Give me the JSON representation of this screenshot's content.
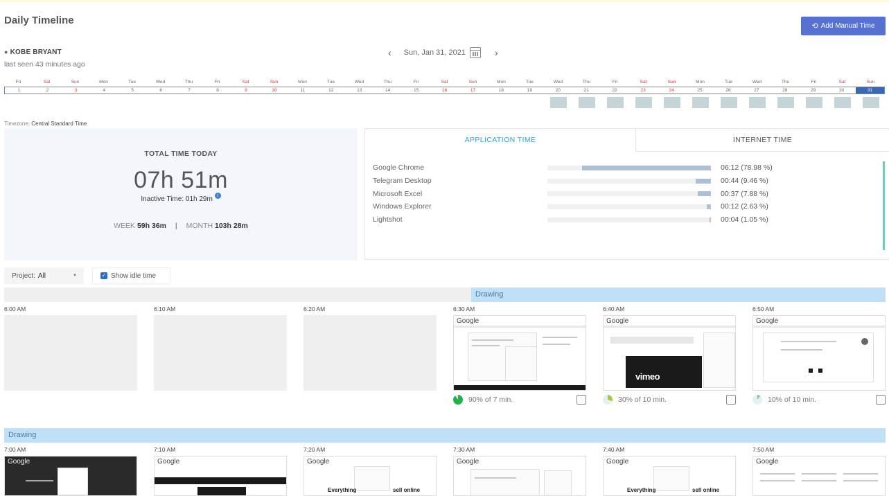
{
  "header": {
    "title": "Daily Timeline",
    "add_manual_time": "Add Manual Time",
    "add_icon": "clock-plus-icon"
  },
  "user": {
    "name": "KOBE BRYANT",
    "last_seen": "last seen 43 minutes ago"
  },
  "date_nav": {
    "date": "Sun, Jan 31, 2021"
  },
  "day_strip": {
    "days": [
      "Fri",
      "Sat",
      "Sun",
      "Mon",
      "Tue",
      "Wed",
      "Thu",
      "Fri",
      "Sat",
      "Sun",
      "Mon",
      "Tue",
      "Wed",
      "Thu",
      "Fri",
      "Sat",
      "Sun",
      "Mon",
      "Tue",
      "Wed",
      "Thu",
      "Fri",
      "Sat",
      "Sun",
      "Mon",
      "Tue",
      "Wed",
      "Thu",
      "Fri",
      "Sat",
      "Sun"
    ],
    "numbers": [
      "1",
      "2",
      "3",
      "4",
      "5",
      "6",
      "7",
      "8",
      "9",
      "10",
      "11",
      "12",
      "13",
      "14",
      "15",
      "16",
      "17",
      "18",
      "19",
      "20",
      "21",
      "22",
      "23",
      "24",
      "25",
      "26",
      "27",
      "28",
      "29",
      "30",
      "31"
    ],
    "selected": "31"
  },
  "timezone": {
    "label": "Timezone:",
    "value": "Central Standard Time"
  },
  "totals": {
    "label": "TOTAL TIME TODAY",
    "time": "07h 51m",
    "inactive_label": "Inactive Time:",
    "inactive_value": "01h 29m",
    "week_label": "WEEK",
    "week_value": "59h 36m",
    "separator": "|",
    "month_label": "MONTH",
    "month_value": "103h 28m"
  },
  "tabs": {
    "application": "APPLICATION TIME",
    "internet": "INTERNET TIME"
  },
  "apps": [
    {
      "name": "Google Chrome",
      "value": "06:12 (78.98 %)",
      "percent": 78.98
    },
    {
      "name": "Telegram Desktop",
      "value": "00:44 (9.46 %)",
      "percent": 9.46
    },
    {
      "name": "Microsoft Excel",
      "value": "00:37 (7.88 %)",
      "percent": 7.88
    },
    {
      "name": "Windows Explorer",
      "value": "00:12 (2.63 %)",
      "percent": 2.63
    },
    {
      "name": "Lightshot",
      "value": "00:04 (1.05 %)",
      "percent": 1.05
    }
  ],
  "filters": {
    "project_label": "Project:",
    "project_value": "All",
    "show_idle": "Show idle time"
  },
  "bands": {
    "row1": "Drawing",
    "row2": "Drawing"
  },
  "row1": [
    {
      "time": "6:00 AM"
    },
    {
      "time": "6:10 AM"
    },
    {
      "time": "6:20 AM"
    },
    {
      "time": "6:30 AM",
      "site": "Google",
      "activity": "90% of 7 min.",
      "color": "#22b14c"
    },
    {
      "time": "6:40 AM",
      "site": "Google",
      "activity": "30% of 10 min.",
      "color": "#a8c93a",
      "video_text": "vimeo"
    },
    {
      "time": "6:50 AM",
      "site": "Google",
      "activity": "10% of 10 min.",
      "color": "#88c28a"
    }
  ],
  "row2": [
    {
      "time": "7:00 AM",
      "site": "Google"
    },
    {
      "time": "7:10 AM",
      "site": "Google"
    },
    {
      "time": "7:20 AM",
      "site": "Google",
      "headline": "Everything",
      "headline2": "sell online"
    },
    {
      "time": "7:30 AM",
      "site": "Google"
    },
    {
      "time": "7:40 AM",
      "site": "Google",
      "headline": "Everything",
      "headline2": "sell online"
    },
    {
      "time": "7:50 AM",
      "site": "Google"
    }
  ]
}
